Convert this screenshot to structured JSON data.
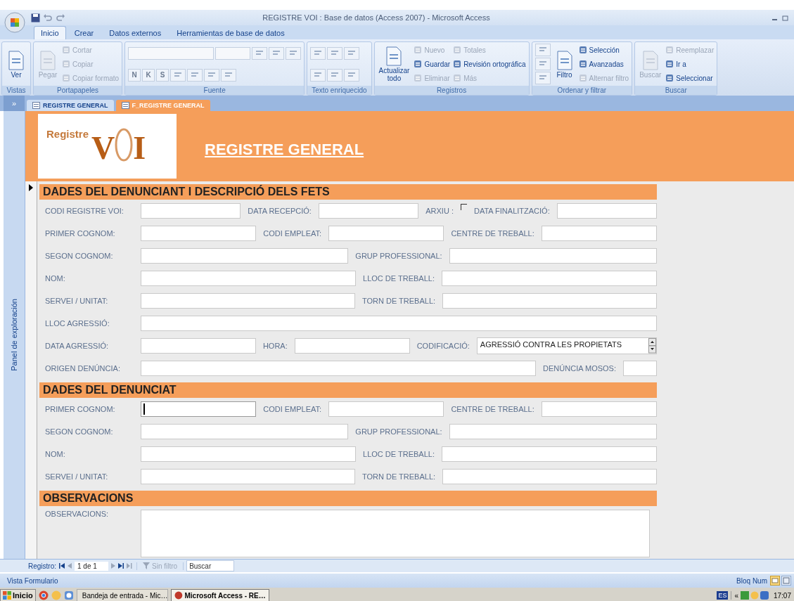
{
  "title_bar": {
    "title": "REGISTRE VOI : Base de datos (Access 2007) - Microsoft Access"
  },
  "ribbon": {
    "tabs": [
      {
        "label": "Inicio",
        "selected": true
      },
      {
        "label": "Crear",
        "selected": false
      },
      {
        "label": "Datos externos",
        "selected": false
      },
      {
        "label": "Herramientas de base de datos",
        "selected": false
      }
    ],
    "groups": [
      {
        "label": "Vistas",
        "kind": "columns",
        "lines": [
          [
            {
              "kind": "large",
              "text": "Ver",
              "disabled": false
            }
          ]
        ]
      },
      {
        "label": "Portapapeles",
        "kind": "columns",
        "lines": [
          [
            {
              "kind": "large",
              "text": "Pegar",
              "disabled": true
            }
          ],
          [
            {
              "kind": "small",
              "text": "Cortar",
              "disabled": true
            },
            {
              "kind": "small",
              "text": "Copiar",
              "disabled": true
            },
            {
              "kind": "small",
              "text": "Copiar formato",
              "disabled": true
            }
          ]
        ]
      },
      {
        "label": "Fuente",
        "kind": "rows",
        "lines": [
          [
            {
              "kind": "font-box"
            },
            {
              "kind": "size-box"
            },
            {
              "kind": "tool"
            },
            {
              "kind": "tool"
            },
            {
              "kind": "tool"
            }
          ],
          [
            {
              "kind": "toggle",
              "text": "N"
            },
            {
              "kind": "toggle",
              "text": "K"
            },
            {
              "kind": "toggle",
              "text": "S"
            },
            {
              "kind": "tool"
            },
            {
              "kind": "tool"
            },
            {
              "kind": "tool"
            },
            {
              "kind": "tool"
            }
          ]
        ]
      },
      {
        "label": "Texto enriquecido",
        "kind": "rows",
        "lines": [
          [
            {
              "kind": "tool"
            },
            {
              "kind": "tool"
            },
            {
              "kind": "tool"
            }
          ],
          [
            {
              "kind": "tool"
            },
            {
              "kind": "tool"
            },
            {
              "kind": "tool"
            }
          ]
        ]
      },
      {
        "label": "Registros",
        "kind": "columns",
        "lines": [
          [
            {
              "kind": "large",
              "text": "Actualizar todo",
              "disabled": false
            }
          ],
          [
            {
              "kind": "small",
              "text": "Nuevo",
              "disabled": true
            },
            {
              "kind": "small",
              "text": "Guardar",
              "disabled": false
            },
            {
              "kind": "small",
              "text": "Eliminar",
              "disabled": true
            }
          ],
          [
            {
              "kind": "small",
              "text": "Totales",
              "disabled": true
            },
            {
              "kind": "small",
              "text": "Revisión ortográfica",
              "disabled": false
            },
            {
              "kind": "small",
              "text": "Más",
              "disabled": true
            }
          ]
        ]
      },
      {
        "label": "Ordenar y filtrar",
        "kind": "columns",
        "lines": [
          [
            {
              "kind": "tool"
            },
            {
              "kind": "tool"
            },
            {
              "kind": "tool"
            }
          ],
          [
            {
              "kind": "large",
              "text": "Filtro",
              "disabled": false
            }
          ],
          [
            {
              "kind": "small",
              "text": "Selección",
              "disabled": false
            },
            {
              "kind": "small",
              "text": "Avanzadas",
              "disabled": false
            },
            {
              "kind": "small",
              "text": "Alternar filtro",
              "disabled": true
            }
          ]
        ]
      },
      {
        "label": "Buscar",
        "kind": "columns",
        "lines": [
          [
            {
              "kind": "large",
              "text": "Buscar",
              "disabled": true
            }
          ],
          [
            {
              "kind": "small",
              "text": "Reemplazar",
              "disabled": true
            },
            {
              "kind": "small",
              "text": "Ir a",
              "disabled": false
            },
            {
              "kind": "small",
              "text": "Seleccionar",
              "disabled": false
            }
          ]
        ]
      }
    ]
  },
  "nav_pane": {
    "toggle": "»",
    "label": "Panel de exploración"
  },
  "doc_tabs": [
    {
      "label": "REGISTRE GENERAL",
      "selected": false
    },
    {
      "label": "F_REGISTRE GENERAL",
      "selected": true
    }
  ],
  "form": {
    "logo": {
      "caption": "Registre",
      "letters": [
        "V",
        "I"
      ]
    },
    "title": "REGISTRE GENERAL",
    "sections": [
      {
        "title": "DADES DEL DENUNCIANT I DESCRIPCIÓ DELS FETS",
        "rows": [
          {
            "fields": [
              {
                "label": "CODI REGISTRE VOI:",
                "kind": "text",
                "focused": false
              },
              {
                "label": "DATA RECEPCIÓ:",
                "kind": "text",
                "focused": false
              },
              {
                "label": "ARXIU :",
                "kind": "checkbox",
                "checked": false
              },
              {
                "label": "DATA FINALITZACIÓ:",
                "kind": "text",
                "focused": false
              }
            ]
          },
          {
            "fields": [
              {
                "label": "PRIMER COGNOM:",
                "kind": "text",
                "focused": false
              },
              {
                "label": "CODI EMPLEAT:",
                "kind": "text",
                "focused": false
              },
              {
                "label": "CENTRE DE TREBALL:",
                "kind": "text",
                "focused": false
              }
            ]
          },
          {
            "fields": [
              {
                "label": "SEGON COGNOM:",
                "kind": "text",
                "focused": false
              },
              {
                "label": "GRUP PROFESSIONAL:",
                "kind": "text",
                "focused": false
              }
            ]
          },
          {
            "fields": [
              {
                "label": "NOM:",
                "kind": "text",
                "focused": false
              },
              {
                "label": "LLOC DE TREBALL:",
                "kind": "text",
                "focused": false
              }
            ]
          },
          {
            "fields": [
              {
                "label": "SERVEI / UNITAT:",
                "kind": "text",
                "focused": false
              },
              {
                "label": "TORN DE TREBALL:",
                "kind": "text",
                "focused": false
              }
            ]
          },
          {
            "fields": [
              {
                "label": "LLOC AGRESSIÓ:",
                "kind": "text",
                "focused": false
              }
            ]
          },
          {
            "fields": [
              {
                "label": "DATA AGRESSIÓ:",
                "kind": "text",
                "focused": false
              },
              {
                "label": "HORA:",
                "kind": "text",
                "focused": false
              },
              {
                "label": "CODIFICACIÓ:",
                "kind": "combo",
                "value": "AGRESSIÓ CONTRA LES PROPIETATS"
              }
            ]
          },
          {
            "fields": [
              {
                "label": "ORIGEN DENÚNCIA:",
                "kind": "text",
                "focused": false
              },
              {
                "label": "DENÚNCIA MOSOS:",
                "kind": "short",
                "focused": false
              }
            ]
          }
        ]
      },
      {
        "title": "DADES DEL DENUNCIAT",
        "rows": [
          {
            "fields": [
              {
                "label": "PRIMER COGNOM:",
                "kind": "text",
                "focused": true
              },
              {
                "label": "CODI EMPLEAT:",
                "kind": "text",
                "focused": false
              },
              {
                "label": "CENTRE DE TREBALL:",
                "kind": "text",
                "focused": false
              }
            ]
          },
          {
            "fields": [
              {
                "label": "SEGON COGNOM:",
                "kind": "text",
                "focused": false
              },
              {
                "label": "GRUP PROFESSIONAL:",
                "kind": "text",
                "focused": false
              }
            ]
          },
          {
            "fields": [
              {
                "label": "NOM:",
                "kind": "text",
                "focused": false
              },
              {
                "label": "LLOC DE TREBALL:",
                "kind": "text",
                "focused": false
              }
            ]
          },
          {
            "fields": [
              {
                "label": "SERVEI / UNITAT:",
                "kind": "text",
                "focused": false
              },
              {
                "label": "TORN DE TREBALL:",
                "kind": "text",
                "focused": false
              }
            ]
          }
        ]
      },
      {
        "title": "OBSERVACIONS",
        "rows": [
          {
            "fields": [
              {
                "label": "OBSERVACIONS:",
                "kind": "memo"
              }
            ]
          }
        ]
      }
    ]
  },
  "record_nav": {
    "label": "Registro:",
    "position": "1 de 1",
    "filter": "Sin filtro",
    "search_placeholder": "Buscar"
  },
  "status_bar": {
    "view": "Vista Formulario",
    "indicator": "Bloq Num"
  },
  "taskbar": {
    "start": "Inicio",
    "tasks": [
      {
        "label": "Bandeja de entrada - Mic…",
        "selected": false
      },
      {
        "label": "Microsoft Access - RE…",
        "selected": true
      }
    ],
    "language": "ES",
    "tray_toggle": "«",
    "clock": "17:07"
  }
}
